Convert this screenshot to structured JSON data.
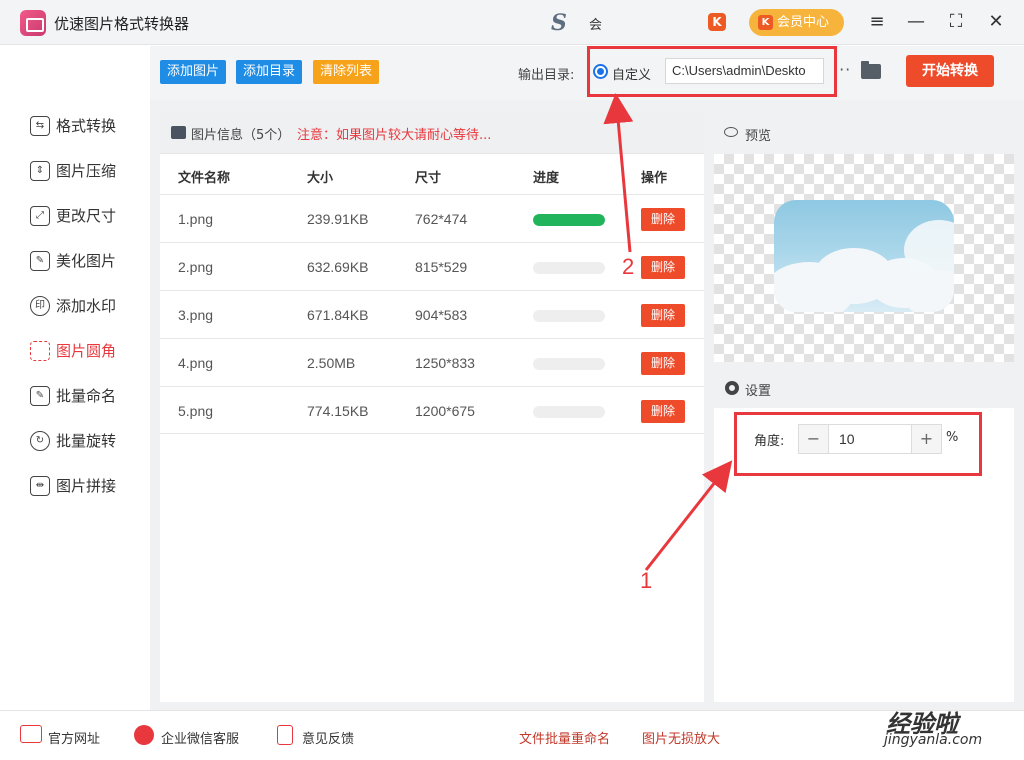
{
  "app": {
    "title": "优速图片格式转换器",
    "user_name": "会",
    "vip_label": "会员中心",
    "brand_glyph": "K"
  },
  "window_controls": {
    "menu": "≡",
    "minimize": "—",
    "maximize": "⛶",
    "close": "✕"
  },
  "toolbar": {
    "add_images": "添加图片",
    "add_folder": "添加目录",
    "clear_list": "清除列表",
    "output_label": "输出目录:",
    "custom_option": "自定义",
    "output_path": "C:\\Users\\admin\\Deskto",
    "more": "···",
    "start": "开始转换"
  },
  "sidebar": {
    "items": [
      {
        "label": "格式转换",
        "icon": "format-convert-icon",
        "active": false
      },
      {
        "label": "图片压缩",
        "icon": "compress-icon",
        "active": false
      },
      {
        "label": "更改尺寸",
        "icon": "resize-icon",
        "active": false
      },
      {
        "label": "美化图片",
        "icon": "beautify-icon",
        "active": false
      },
      {
        "label": "添加水印",
        "icon": "watermark-icon",
        "active": false
      },
      {
        "label": "图片圆角",
        "icon": "rounded-corner-icon",
        "active": true
      },
      {
        "label": "批量命名",
        "icon": "rename-icon",
        "active": false
      },
      {
        "label": "批量旋转",
        "icon": "rotate-icon",
        "active": false
      },
      {
        "label": "图片拼接",
        "icon": "stitch-icon",
        "active": false
      }
    ]
  },
  "file_panel": {
    "info": "图片信息（5个）",
    "warning": "注意：如果图片较大请耐心等待...",
    "columns": [
      "文件名称",
      "大小",
      "尺寸",
      "进度",
      "操作"
    ],
    "rows": [
      {
        "name": "1.png",
        "size": "239.91KB",
        "dims": "762*474",
        "progress": 100
      },
      {
        "name": "2.png",
        "size": "632.69KB",
        "dims": "815*529",
        "progress": 0
      },
      {
        "name": "3.png",
        "size": "671.84KB",
        "dims": "904*583",
        "progress": 0
      },
      {
        "name": "4.png",
        "size": "2.50MB",
        "dims": "1250*833",
        "progress": 0
      },
      {
        "name": "5.png",
        "size": "774.15KB",
        "dims": "1200*675",
        "progress": 0
      }
    ],
    "delete_label": "删除"
  },
  "preview": {
    "title": "预览"
  },
  "settings": {
    "title": "设置",
    "angle_label": "角度:",
    "angle_value": "10",
    "unit": "%",
    "minus": "−",
    "plus": "+"
  },
  "annotations": {
    "n1": "1",
    "n2": "2"
  },
  "footer": {
    "website": "官方网址",
    "wechat": "企业微信客服",
    "feedback": "意见反馈",
    "link1": "文件批量重命名",
    "link2": "图片无损放大",
    "watermark": "经验啦",
    "watermark_sub": "jingyanla.com"
  },
  "colors": {
    "accent_red": "#ee4b2b",
    "blue": "#1f8ce6",
    "orange": "#f7a21b",
    "progress_green": "#21b45a",
    "annotation_red": "#e8383d"
  }
}
